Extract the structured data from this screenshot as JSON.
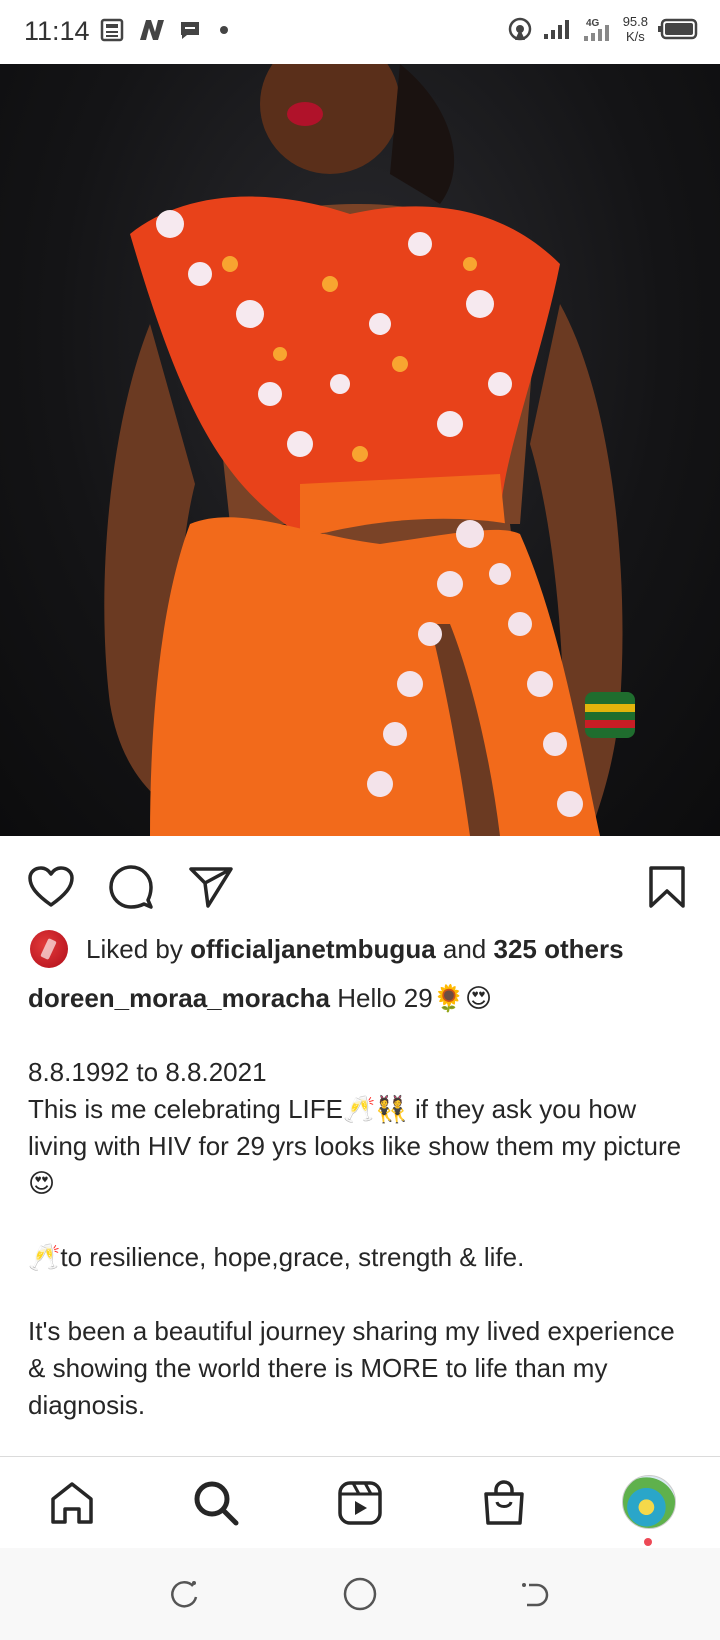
{
  "status_bar": {
    "time": "11:14",
    "network": "4G",
    "speed_value": "95.8",
    "speed_unit": "K/s"
  },
  "post": {
    "photo_description_icon": "photo",
    "liked_by_prefix": "Liked by",
    "liked_by_user": "officialjanetmbugua",
    "liked_by_and": "and",
    "liked_by_others": "325 others",
    "author": "doreen_moraa_moracha",
    "caption_first_line": "Hello 29🌻😍",
    "caption_lines": [
      "8.8.1992 to 8.8.2021",
      "This is me celebrating LIFE🥂👯 if they ask you how living with HIV for 29 yrs looks like show them my picture😍",
      "🥂to resilience, hope,grace, strength & life.",
      "It's been a beautiful journey sharing my lived experience & showing the world there is MORE to life than my diagnosis."
    ]
  },
  "colors": {
    "notification_dot": "#ed4956",
    "photo_background": "#141416",
    "dress": "#f26a1b"
  }
}
